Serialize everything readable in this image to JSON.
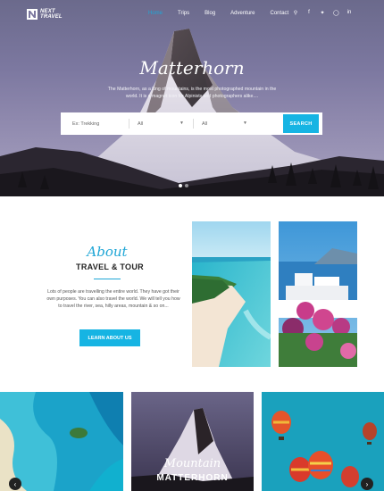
{
  "brand": {
    "line1": "NEXT",
    "line2": "TRAVEL"
  },
  "nav": {
    "items": [
      {
        "label": "Home",
        "active": true
      },
      {
        "label": "Trips",
        "active": false
      },
      {
        "label": "Blog",
        "active": false
      },
      {
        "label": "Adventure",
        "active": false
      },
      {
        "label": "Contact",
        "active": false
      }
    ],
    "icons": [
      "search-icon",
      "facebook-icon",
      "twitter-icon",
      "instagram-icon",
      "linkedin-icon"
    ]
  },
  "hero": {
    "title": "Matterhorn",
    "description": "The Matterhorn, as a king of mountains, is the most photographed mountain in the world. It is a magnet icon for Alpinists and photographers alike....",
    "search": {
      "placeholder": "Ex: Trekking",
      "select1": "All",
      "select2": "All",
      "button": "SEARCH"
    },
    "slides": 2,
    "active_slide": 1
  },
  "about": {
    "script_title": "About",
    "subtitle": "TRAVEL & TOUR",
    "text": "Lots of people are travelling the entire world. They have got their own purposes. You can also travel the world. We will tell you how to travel the river, sea, hilly areas, mountain & so on...",
    "button": "LEARN ABOUT US"
  },
  "tiles": {
    "center_script": "Mountain",
    "center_sub": "MATTERHORN"
  },
  "colors": {
    "accent": "#16b4e3",
    "text_dark": "#222222",
    "text_muted": "#555555"
  }
}
